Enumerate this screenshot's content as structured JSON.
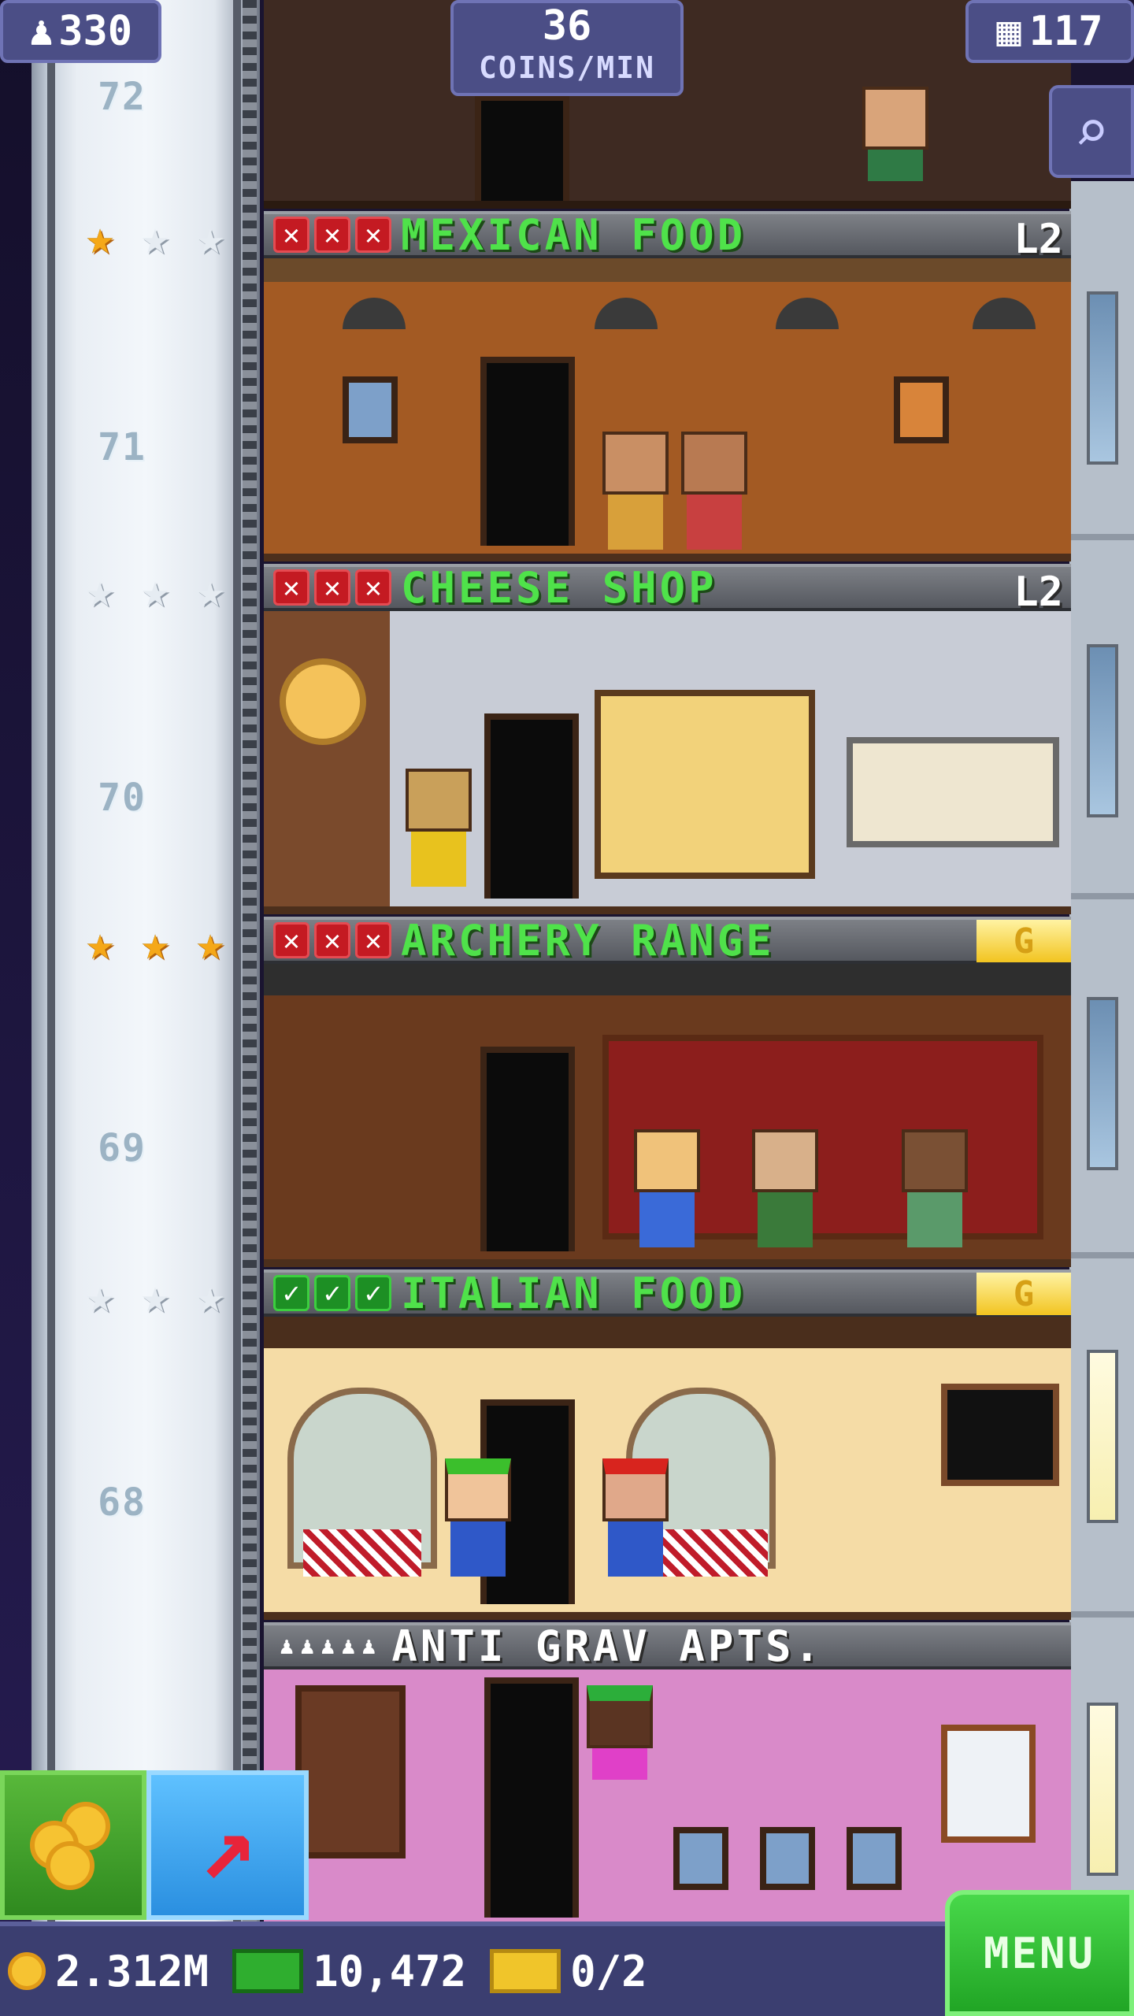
{
  "hud": {
    "population": "330",
    "coins_per_min_value": "36",
    "coins_per_min_label": "COINS/MIN",
    "floors": "117"
  },
  "elevator": {
    "floor_numbers": [
      "72",
      "71",
      "70",
      "69",
      "68"
    ]
  },
  "floors": [
    {
      "name": "MEXICAN FOOD",
      "level": "L2",
      "stars": [
        "gold",
        "silver",
        "silver"
      ],
      "stock": [
        "x",
        "x",
        "x"
      ]
    },
    {
      "name": "CHEESE SHOP",
      "level": "L2",
      "stars": [
        "silver",
        "silver",
        "silver"
      ],
      "stock": [
        "x",
        "x",
        "x"
      ]
    },
    {
      "name": "ARCHERY RANGE",
      "badge": "G",
      "stars": [
        "gold",
        "gold",
        "gold"
      ],
      "stock": [
        "x",
        "x",
        "x"
      ]
    },
    {
      "name": "ITALIAN FOOD",
      "badge": "G",
      "stars": [
        "silver",
        "silver",
        "silver"
      ],
      "stock": [
        "ok",
        "ok",
        "ok"
      ]
    },
    {
      "name": "ANTI GRAV APTS.",
      "residents": 5
    }
  ],
  "bottom_bar": {
    "coins": "2.312M",
    "bux": "10,472",
    "vip": "0/2",
    "menu_label": "MENU"
  },
  "icons": {
    "population": "person-icon",
    "floors": "building-icon",
    "search": "magnifier-icon",
    "coins_button": "coins-icon",
    "elevator_button": "arrow-up-icon"
  },
  "colors": {
    "hud_bg": "#4b4e86",
    "store_name": "#4fe24a",
    "stock_empty": "#c41a22",
    "stock_full": "#1d8f24",
    "menu_green": "#21a525"
  }
}
